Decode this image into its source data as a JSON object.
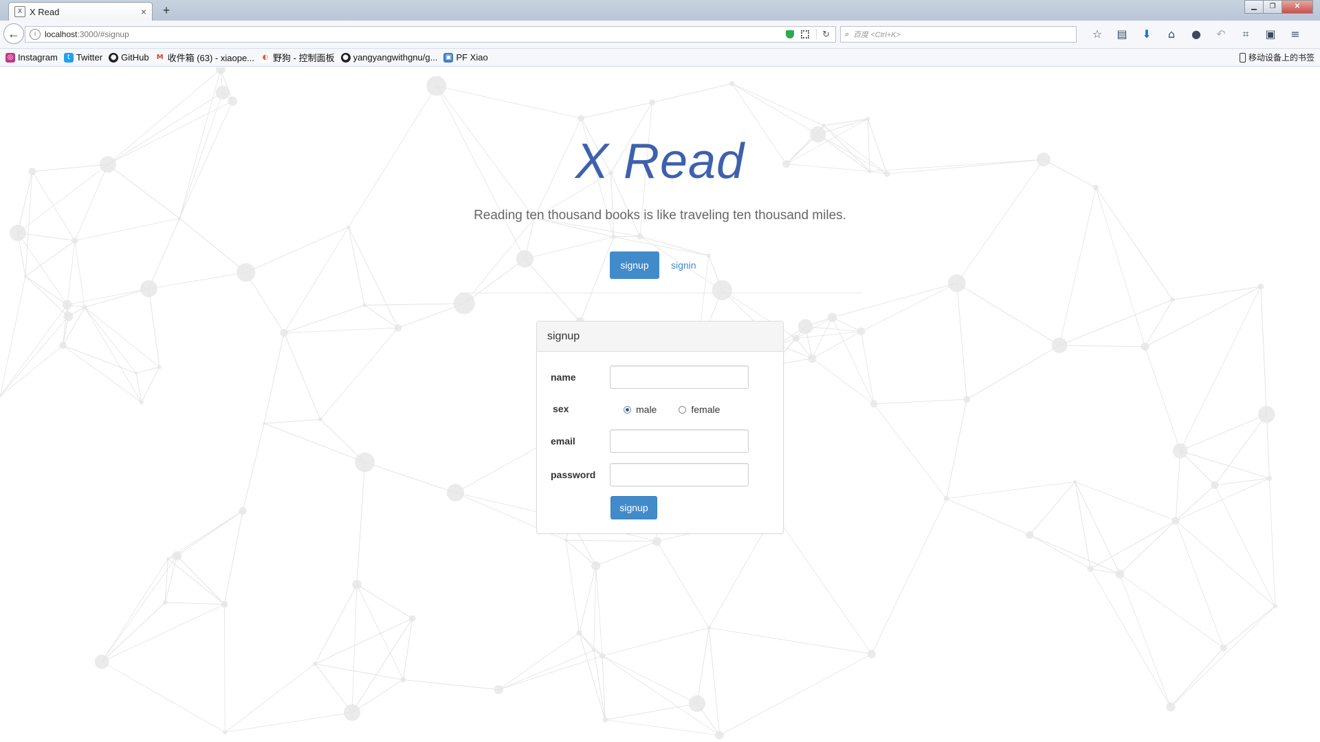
{
  "browser": {
    "tab_title": "X Read",
    "tab_close": "×",
    "new_tab": "+",
    "url_host": "localhost",
    "url_path": ":3000/#signup",
    "search_placeholder": "百度 <Ctrl+K>",
    "bookmarks": [
      {
        "label": "Instagram",
        "icon": "instagram-icon",
        "color": "#c13584"
      },
      {
        "label": "Twitter",
        "icon": "twitter-icon",
        "color": "#1da1f2"
      },
      {
        "label": "GitHub",
        "icon": "github-icon",
        "color": "#222222"
      },
      {
        "label": "收件箱 (63) - xiaope...",
        "icon": "gmail-icon",
        "color": "#d23f31"
      },
      {
        "label": "野狗 - 控制面板",
        "icon": "wilddog-icon",
        "color": "#e8572b"
      },
      {
        "label": "yangyangwithgnu/g...",
        "icon": "github-icon",
        "color": "#222222"
      },
      {
        "label": "PF Xiao",
        "icon": "pf-icon",
        "color": "#3b7dc4"
      }
    ],
    "mobile_bookmarks": "移动设备上的书签"
  },
  "app": {
    "title": "X Read",
    "tagline": "Reading ten thousand books is like traveling ten thousand miles.",
    "nav": {
      "active": "signup",
      "link": "signin"
    },
    "accent": "#428bca",
    "title_color": "#3e61ad"
  },
  "form": {
    "heading": "signup",
    "name_label": "name",
    "sex_label": "sex",
    "sex_options": [
      "male",
      "female"
    ],
    "sex_selected": "male",
    "email_label": "email",
    "password_label": "password",
    "name_value": "",
    "email_value": "",
    "password_value": "",
    "submit_label": "signup"
  }
}
